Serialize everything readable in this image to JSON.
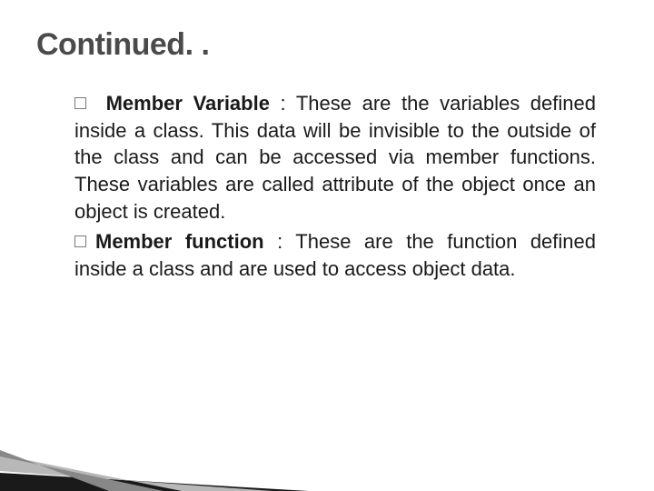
{
  "slide": {
    "title": "Continued. .",
    "bullets": [
      {
        "term": "Member Variable",
        "text": " : These are the variables defined inside a class. This data will be invisible to the outside of the class and can be accessed via member functions. These variables are called attribute of the object once an object is created."
      },
      {
        "term": "Member function",
        "text": " : These are the function defined inside a class and are used to access object data."
      }
    ]
  }
}
